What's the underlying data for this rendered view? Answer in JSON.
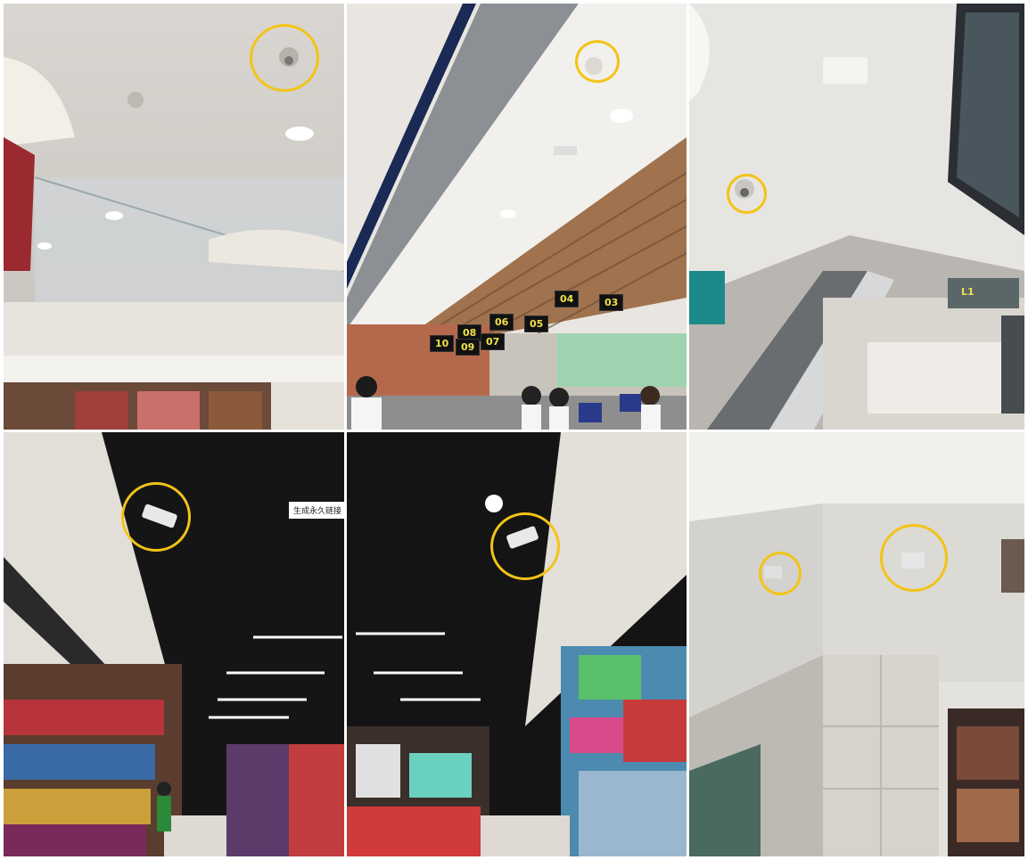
{
  "image": {
    "description": "Six-photo collage of surveillance cameras in a shopping mall and supermarket, each camera circled in yellow",
    "highlight_color": "#f2c417",
    "highlight_shape": "circle"
  },
  "panels": [
    {
      "scene": "mall atrium ceiling",
      "highlighted": "dome-camera"
    },
    {
      "scene": "supermarket checkout",
      "highlighted": "dome-camera",
      "counter_labels": [
        "04",
        "03",
        "06",
        "05",
        "08",
        "07",
        "10",
        "09"
      ]
    },
    {
      "scene": "escalator hall",
      "highlighted": "dome-camera",
      "signs": {
        "level": "L1"
      }
    },
    {
      "scene": "supermarket aisle",
      "highlighted": "bullet-camera",
      "overlay_text": "生成永久链接"
    },
    {
      "scene": "supermarket aisle",
      "highlighted": "bullet-camera"
    },
    {
      "scene": "building exterior corner",
      "highlighted": "bullet-camera",
      "highlight_count": 2
    }
  ]
}
